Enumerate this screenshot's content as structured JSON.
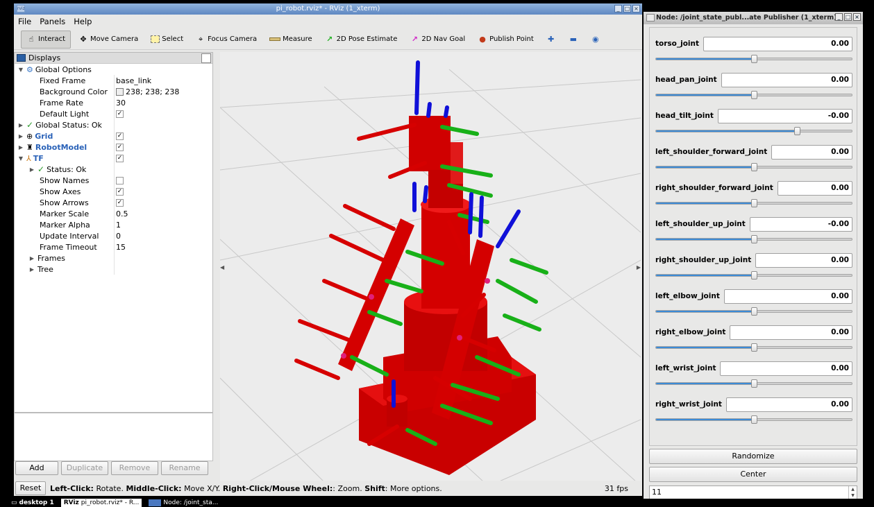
{
  "rviz": {
    "title": "pi_robot.rviz* - RViz (1_xterm)",
    "title_icon": "rviz",
    "menu": [
      "File",
      "Panels",
      "Help"
    ],
    "toolbar": [
      {
        "label": "Interact",
        "icon": "hand-cursor-icon"
      },
      {
        "label": "Move Camera",
        "icon": "move-camera-icon"
      },
      {
        "label": "Select",
        "icon": "select-box-icon"
      },
      {
        "label": "Focus Camera",
        "icon": "focus-camera-icon"
      },
      {
        "label": "Measure",
        "icon": "ruler-icon"
      },
      {
        "label": "2D Pose Estimate",
        "icon": "green-arrow-icon"
      },
      {
        "label": "2D Nav Goal",
        "icon": "magenta-arrow-icon"
      },
      {
        "label": "Publish Point",
        "icon": "map-pin-icon"
      }
    ],
    "displays": {
      "header": "Displays",
      "global_options": "Global Options",
      "fixed_frame_label": "Fixed Frame",
      "fixed_frame_value": "base_link",
      "background_color_label": "Background Color",
      "background_color_value": "238; 238; 238",
      "frame_rate_label": "Frame Rate",
      "frame_rate_value": "30",
      "default_light_label": "Default Light",
      "global_status": "Global Status: Ok",
      "grid": "Grid",
      "robot_model": "RobotModel",
      "tf": "TF",
      "status_ok": "Status: Ok",
      "show_names": "Show Names",
      "show_axes": "Show Axes",
      "show_arrows": "Show Arrows",
      "marker_scale_label": "Marker Scale",
      "marker_scale_value": "0.5",
      "marker_alpha_label": "Marker Alpha",
      "marker_alpha_value": "1",
      "update_interval_label": "Update Interval",
      "update_interval_value": "0",
      "frame_timeout_label": "Frame Timeout",
      "frame_timeout_value": "15",
      "frames": "Frames",
      "tree": "Tree"
    },
    "buttons": {
      "add": "Add",
      "duplicate": "Duplicate",
      "remove": "Remove",
      "rename": "Rename"
    },
    "status": {
      "reset": "Reset",
      "left_click": "Left-Click:",
      "left_desc": "Rotate.",
      "middle_click": "Middle-Click:",
      "middle_desc": "Move X/Y.",
      "right_click": "Right-Click/Mouse Wheel:",
      "right_desc": ": Zoom.",
      "shift": "Shift",
      "shift_desc": ": More options.",
      "fps": "31 fps"
    }
  },
  "jsp": {
    "title": "Node: /joint_state_publ...ate Publisher (1_xterm)",
    "joints": [
      {
        "name": "torso_joint",
        "value": "0.00",
        "position": 0.5
      },
      {
        "name": "head_pan_joint",
        "value": "0.00",
        "position": 0.5
      },
      {
        "name": "head_tilt_joint",
        "value": "-0.00",
        "position": 0.72
      },
      {
        "name": "left_shoulder_forward_joint",
        "value": "0.00",
        "position": 0.5
      },
      {
        "name": "right_shoulder_forward_joint",
        "value": "0.00",
        "position": 0.5
      },
      {
        "name": "left_shoulder_up_joint",
        "value": "-0.00",
        "position": 0.5
      },
      {
        "name": "right_shoulder_up_joint",
        "value": "0.00",
        "position": 0.5
      },
      {
        "name": "left_elbow_joint",
        "value": "0.00",
        "position": 0.5
      },
      {
        "name": "right_elbow_joint",
        "value": "0.00",
        "position": 0.5
      },
      {
        "name": "left_wrist_joint",
        "value": "0.00",
        "position": 0.5
      },
      {
        "name": "right_wrist_joint",
        "value": "0.00",
        "position": 0.5
      }
    ],
    "randomize": "Randomize",
    "center": "Center",
    "spin_value": "11"
  },
  "taskbar": {
    "desktop": "desktop 1",
    "task1": "pi_robot.rviz* - R...",
    "task1_icon": "RViz",
    "task2": "Node: /joint_sta..."
  }
}
